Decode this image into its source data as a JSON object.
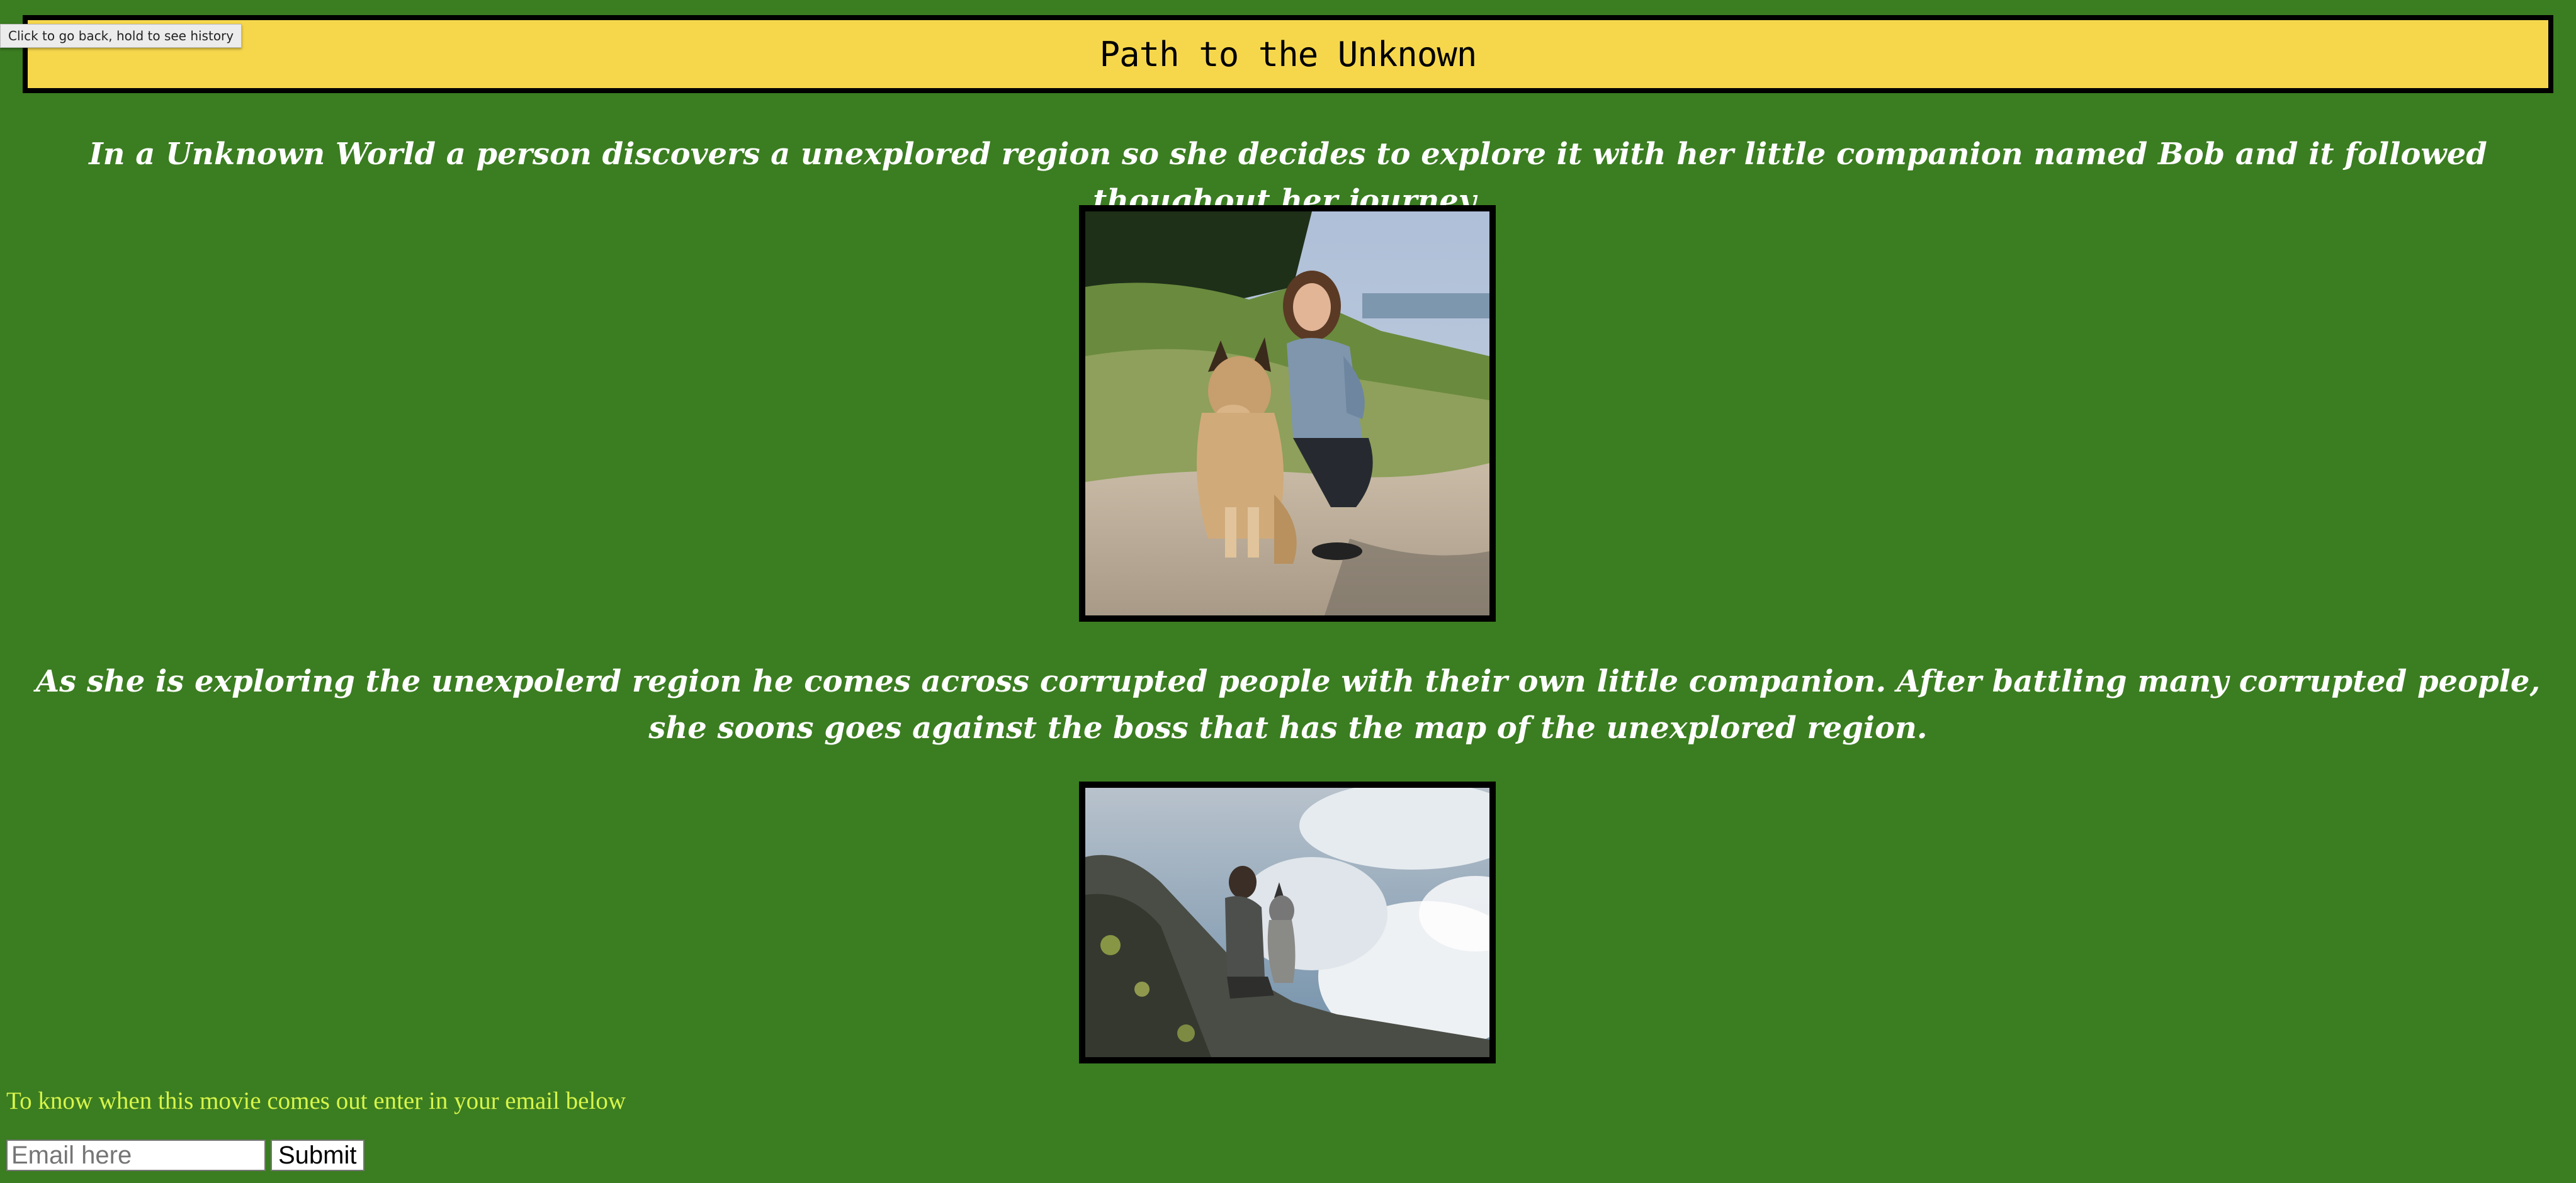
{
  "tooltip": {
    "text": "Click to go back, hold to see history"
  },
  "header": {
    "title": "Path to the Unknown"
  },
  "main": {
    "intro_text": "In a Unknown World a person discovers a unexplored region so she decides to explore it with her little companion named Bob and it followed thoughout her journey.",
    "second_text": "As she is exploring the unexpolerd region he comes across corrupted people with their own little companion. After battling many corrupted people, she soons goes against the boss that has the map of the unexplored region."
  },
  "signup": {
    "prompt": "To know when this movie comes out enter in your email below",
    "email_value": "",
    "email_placeholder": "Email here",
    "submit_label": "Submit"
  },
  "colors": {
    "background": "#3b7d21",
    "title_bar": "#f6d74c",
    "prompt_text": "#d7f54a",
    "body_text": "#ffffff"
  }
}
